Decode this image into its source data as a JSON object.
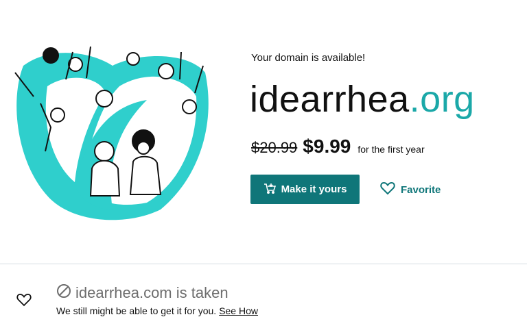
{
  "hero": {
    "illustration": "crowd-of-people-waving-illustration",
    "accent_color": "#2fcfcc"
  },
  "offer": {
    "availability_text": "Your domain is available!",
    "domain_name": "idearrhea",
    "domain_tld": ".org",
    "old_price": "$20.99",
    "new_price": "$9.99",
    "price_note": "for the first year",
    "primary_button_label": "Make it yours",
    "primary_button_icon": "cart-plus-icon",
    "favorite_label": "Favorite",
    "favorite_icon": "heart-outline-icon",
    "brand_color": "#0f7679",
    "tld_color": "#1ba8a8"
  },
  "taken": {
    "icon": "unavailable-circle-slash-icon",
    "title": "idearrhea.com is taken",
    "subtitle": "We still might be able to get it for you.",
    "link_label": "See How",
    "favorite_icon": "heart-outline-icon"
  }
}
